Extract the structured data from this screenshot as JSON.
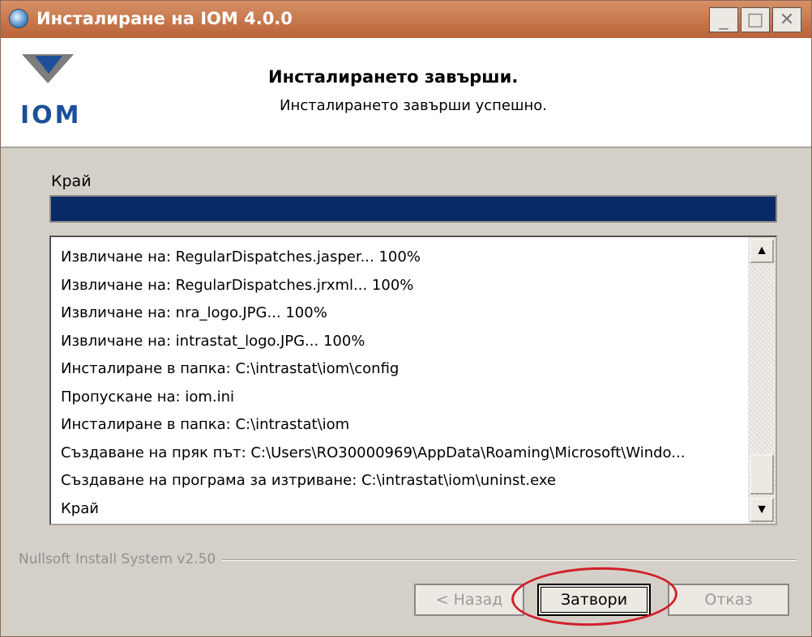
{
  "window": {
    "title": "Инсталиране на IOM 4.0.0",
    "controls": {
      "minimize": "_",
      "maximize": "□",
      "close": "✕"
    }
  },
  "header": {
    "logo_text": "IOM",
    "title": "Инсталирането завърши.",
    "subtitle": "Инсталирането завърши успешно."
  },
  "status": {
    "label": "Край",
    "progress": 1.0
  },
  "log": {
    "lines": [
      "Извличане на: RegularDispatches.jasper... 100%",
      "Извличане на: RegularDispatches.jrxml... 100%",
      "Извличане на: nra_logo.JPG... 100%",
      "Извличане на: intrastat_logo.JPG... 100%",
      "Инсталиране в папка: C:\\intrastat\\iom\\config",
      "Пропускане на: iom.ini",
      "Инсталиране в папка: C:\\intrastat\\iom",
      "Създаване на пряк път: C:\\Users\\RO30000969\\AppData\\Roaming\\Microsoft\\Windo...",
      "Създаване на програма за изтриване: C:\\intrastat\\iom\\uninst.exe",
      "Край"
    ]
  },
  "footer": {
    "branding": "Nullsoft Install System v2.50",
    "back_label": "< Назад",
    "close_label": "Затвори",
    "cancel_label": "Отказ"
  },
  "colors": {
    "titlebar": "#c77548",
    "progress_fill": "#082a66",
    "highlight_ellipse": "#d21f2a"
  }
}
